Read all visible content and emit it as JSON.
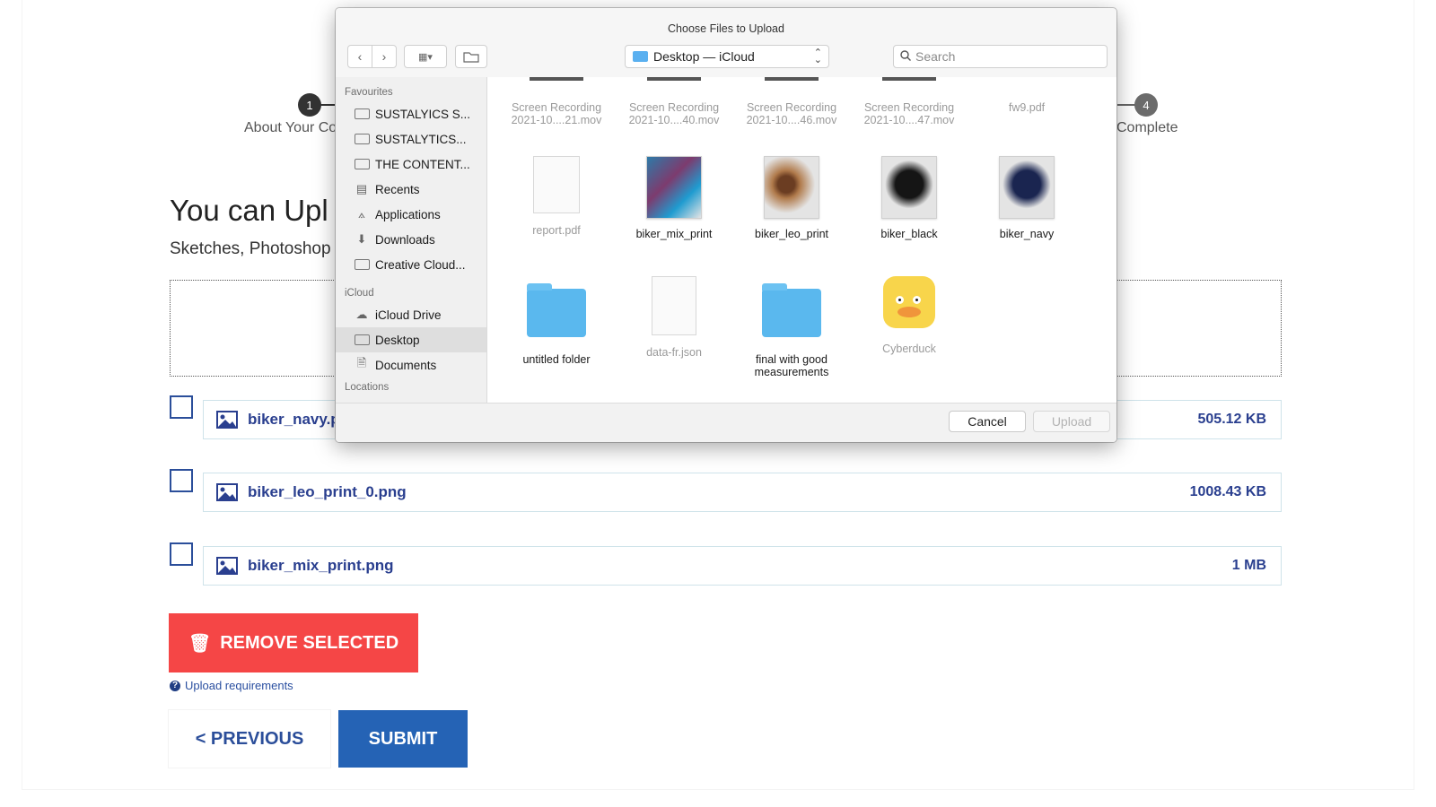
{
  "page": {
    "steps": [
      {
        "number": "1",
        "label": "About Your Co"
      },
      {
        "number": "4",
        "label": "Complete"
      }
    ],
    "heading": "You can Upl",
    "subheading": "Sketches, Photoshop",
    "files": [
      {
        "name": "biker_navy.p",
        "size": "505.12 KB"
      },
      {
        "name": "biker_leo_print_0.png",
        "size": "1008.43 KB"
      },
      {
        "name": "biker_mix_print.png",
        "size": "1 MB"
      }
    ],
    "remove_label": "REMOVE SELECTED",
    "upload_requirements": "Upload requirements",
    "previous_label": "< PREVIOUS",
    "submit_label": "SUBMIT"
  },
  "dialog": {
    "title": "Choose Files to Upload",
    "location": "Desktop — iCloud",
    "search_placeholder": "Search",
    "sidebar": {
      "favourites_label": "Favourites",
      "favourites": [
        "SUSTALYICS S...",
        "SUSTALYTICS...",
        "THE CONTENT...",
        "Recents",
        "Applications",
        "Downloads",
        "Creative Cloud..."
      ],
      "icloud_label": "iCloud",
      "icloud": [
        "iCloud Drive",
        "Desktop",
        "Documents"
      ],
      "locations_label": "Locations"
    },
    "files_row1": [
      {
        "line1": "Screen Recording",
        "line2": "2021-10....21.mov"
      },
      {
        "line1": "Screen Recording",
        "line2": "2021-10....40.mov"
      },
      {
        "line1": "Screen Recording",
        "line2": "2021-10....46.mov"
      },
      {
        "line1": "Screen Recording",
        "line2": "2021-10....47.mov"
      },
      {
        "line1": "fw9.pdf",
        "line2": ""
      }
    ],
    "files_row2": [
      "report.pdf",
      "biker_mix_print",
      "biker_leo_print",
      "biker_black",
      "biker_navy"
    ],
    "files_row3": [
      {
        "line1": "untitled folder",
        "line2": ""
      },
      {
        "line1": "data-fr.json",
        "line2": ""
      },
      {
        "line1": "final with good",
        "line2": "measurements"
      },
      {
        "line1": "Cyberduck",
        "line2": ""
      }
    ],
    "cancel_label": "Cancel",
    "upload_label": "Upload"
  },
  "colors": {
    "remove_button": "#f54646",
    "submit_button": "#2563b5",
    "file_text": "#2a3f8f",
    "folder_blue": "#5ab8ee"
  },
  "icons": {
    "image_file": "image-icon",
    "trash": "trash-icon",
    "help": "question-circle-icon"
  }
}
